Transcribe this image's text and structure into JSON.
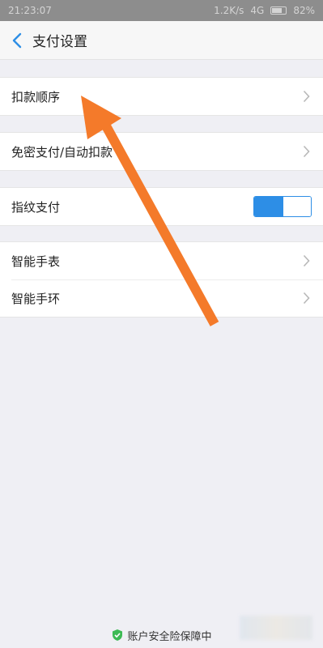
{
  "status_bar": {
    "time": "21:23:07",
    "right_text": "1.2K/s",
    "network": "4G",
    "battery": "82%"
  },
  "nav": {
    "title": "支付设置"
  },
  "groups": {
    "order": {
      "label": "扣款顺序"
    },
    "password_free": {
      "label": "免密支付/自动扣款"
    },
    "fingerprint": {
      "label": "指纹支付",
      "toggle_on": true
    },
    "wearables": {
      "watch": "智能手表",
      "band": "智能手环"
    }
  },
  "footer": {
    "text": "账户安全险保障中"
  },
  "colors": {
    "accent": "#2d8ee6",
    "background": "#efeff4",
    "arrow": "#f47a2a",
    "shield": "#3cba54"
  },
  "icons": {
    "back": "back-chevron-icon",
    "chevron": "chevron-right-icon",
    "shield": "shield-icon"
  }
}
